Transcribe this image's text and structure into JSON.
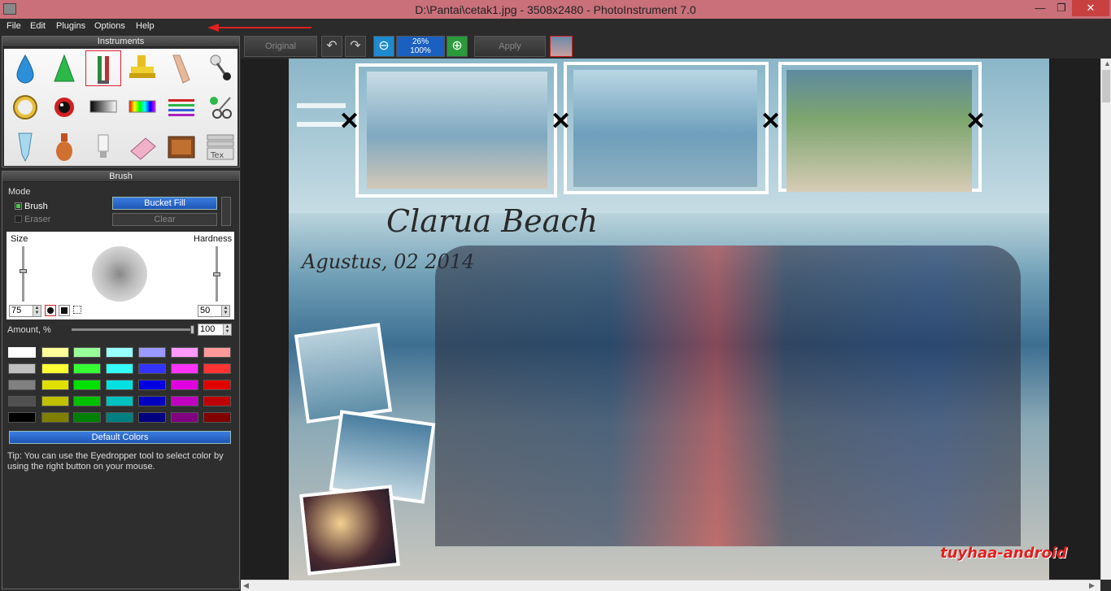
{
  "window": {
    "title": "D:\\Pantai\\cetak1.jpg - 3508x2480 - PhotoInstrument 7.0",
    "minimize": "—",
    "maximize": "❐",
    "close": "✕"
  },
  "menu": [
    "File",
    "Edit",
    "Plugins",
    "Options",
    "Help"
  ],
  "instruments": {
    "header": "Instruments",
    "tools": [
      "water-drop-icon",
      "cone-icon",
      "brush-icon",
      "stamp-icon",
      "finger-icon",
      "pin-icon",
      "clock-icon",
      "eye-icon",
      "gradient-icon",
      "rainbow-icon",
      "lines-icon",
      "scissors-icon",
      "tube-icon",
      "vase-icon",
      "bulb-icon",
      "eraser-icon",
      "tv-icon",
      "text-icon"
    ],
    "selected": "brush-icon"
  },
  "brush": {
    "header": "Brush",
    "mode_label": "Mode",
    "brush_label": "Brush",
    "eraser_label": "Eraser",
    "bucket_fill": "Bucket Fill",
    "clear": "Clear",
    "size_label": "Size",
    "hardness_label": "Hardness",
    "size_value": "75",
    "hardness_value": "50",
    "amount_label": "Amount, %",
    "amount_value": "100",
    "default_colors": "Default Colors",
    "tip": "Tip: You can use the Eyedropper tool to select color by using the right button on your mouse."
  },
  "palette": [
    [
      "#ffffff",
      "#ffff99",
      "#99ff99",
      "#99ffff",
      "#9999ff",
      "#ff99ff",
      "#ff9999"
    ],
    [
      "#c0c0c0",
      "#ffff33",
      "#33ff33",
      "#33ffff",
      "#3333ff",
      "#ff33ff",
      "#ff3333"
    ],
    [
      "#808080",
      "#e0e000",
      "#00e000",
      "#00e0e0",
      "#0000e0",
      "#e000e0",
      "#e00000"
    ],
    [
      "#505050",
      "#c0c000",
      "#00c000",
      "#00c0c0",
      "#0000c0",
      "#c000c0",
      "#c00000"
    ],
    [
      "#000000",
      "#808000",
      "#008000",
      "#008080",
      "#000080",
      "#800080",
      "#800000"
    ]
  ],
  "toolbar": {
    "original": "Original",
    "zoom_top": "26%",
    "zoom_bottom": "100%",
    "apply": "Apply"
  },
  "canvas": {
    "caption_title": "Clarua Beach",
    "caption_date": "Agustus, 02 2014",
    "watermark": "tuyhaa-android"
  }
}
